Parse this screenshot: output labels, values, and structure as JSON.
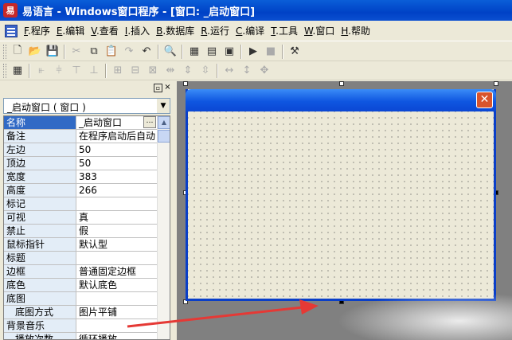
{
  "title_bar": {
    "icon_label": "易",
    "title": "易语言 - Windows窗口程序 - [窗口: _启动窗口]"
  },
  "menu": [
    {
      "key": "F",
      "label": "程序"
    },
    {
      "key": "E",
      "label": "编辑"
    },
    {
      "key": "V",
      "label": "查看"
    },
    {
      "key": "I",
      "label": "插入"
    },
    {
      "key": "B",
      "label": "数据库"
    },
    {
      "key": "R",
      "label": "运行"
    },
    {
      "key": "C",
      "label": "编译"
    },
    {
      "key": "T",
      "label": "工具"
    },
    {
      "key": "W",
      "label": "窗口"
    },
    {
      "key": "H",
      "label": "帮助"
    }
  ],
  "toolbar1_icons": [
    "new-file-icon",
    "open-folder-icon",
    "save-icon",
    "cut-icon",
    "copy-icon",
    "paste-icon",
    "redo-icon",
    "undo-icon",
    "find-icon",
    "layout-left-icon",
    "layout-top-icon",
    "layout-full-icon",
    "run-icon",
    "stop-icon",
    "debug-icon"
  ],
  "property_panel": {
    "pin_glyph": "▫",
    "close_glyph": "×",
    "selector_value": "_启动窗口 ( 窗口 )",
    "more_glyph": "…",
    "properties": [
      {
        "name": "名称",
        "value": "_启动窗口",
        "selected": true
      },
      {
        "name": "备注",
        "value": "在程序启动后自动"
      },
      {
        "name": "左边",
        "value": "50"
      },
      {
        "name": "顶边",
        "value": "50"
      },
      {
        "name": "宽度",
        "value": "383"
      },
      {
        "name": "高度",
        "value": "266"
      },
      {
        "name": "标记",
        "value": ""
      },
      {
        "name": "可视",
        "value": "真"
      },
      {
        "name": "禁止",
        "value": "假"
      },
      {
        "name": "鼠标指针",
        "value": "默认型"
      },
      {
        "name": "标题",
        "value": ""
      },
      {
        "name": "边框",
        "value": "普通固定边框"
      },
      {
        "name": "底色",
        "value": "默认底色"
      },
      {
        "name": "底图",
        "value": ""
      },
      {
        "name": "底图方式",
        "value": "图片平铺",
        "sub": true
      },
      {
        "name": "背景音乐",
        "value": ""
      },
      {
        "name": "播放次数",
        "value": "循环播放",
        "sub": true
      }
    ]
  },
  "design_form": {
    "close_glyph": "✕"
  },
  "colors": {
    "titlebar": "#0042c6",
    "form_border": "#0a3fc8",
    "arrow": "#e53935"
  }
}
